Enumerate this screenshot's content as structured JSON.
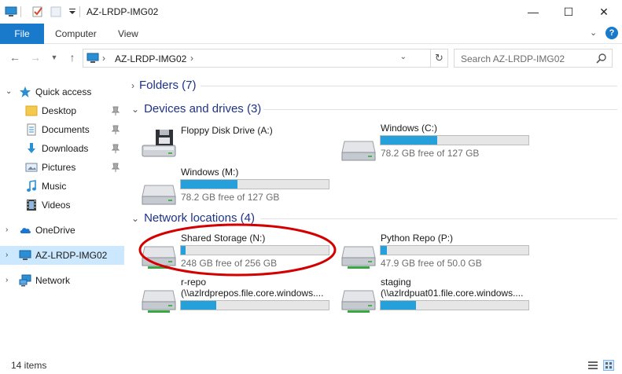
{
  "window": {
    "title": "AZ-LRDP-IMG02",
    "minimize": "—",
    "maximize": "☐",
    "close": "✕"
  },
  "ribbon": {
    "file": "File",
    "computer": "Computer",
    "view": "View",
    "help": "?"
  },
  "address": {
    "path": "AZ-LRDP-IMG02",
    "search_placeholder": "Search AZ-LRDP-IMG02"
  },
  "sidebar": {
    "quick_access": "Quick access",
    "desktop": "Desktop",
    "documents": "Documents",
    "downloads": "Downloads",
    "pictures": "Pictures",
    "music": "Music",
    "videos": "Videos",
    "onedrive": "OneDrive",
    "this_pc": "AZ-LRDP-IMG02",
    "network": "Network"
  },
  "groups": {
    "folders": "Folders (7)",
    "devices": "Devices and drives (3)",
    "network": "Network locations (4)"
  },
  "devices": {
    "floppy": {
      "name": "Floppy Disk Drive (A:)"
    },
    "c": {
      "name": "Windows (C:)",
      "free": "78.2 GB free of 127 GB",
      "used_fraction": 0.384
    },
    "m": {
      "name": "Windows (M:)",
      "free": "78.2 GB free of 127 GB",
      "used_fraction": 0.384
    }
  },
  "network_locations": {
    "n": {
      "name": "Shared Storage (N:)",
      "free": "248 GB free of 256 GB",
      "used_fraction": 0.031
    },
    "p": {
      "name": "Python Repo (P:)",
      "free": "47.9 GB free of 50.0 GB",
      "used_fraction": 0.042
    },
    "r": {
      "name": "r-repo",
      "path": "(\\\\azlrdprepos.file.core.windows....",
      "used_fraction": 0.24
    },
    "s": {
      "name": "staging",
      "path": "(\\\\azlrdpuat01.file.core.windows....",
      "used_fraction": 0.24
    }
  },
  "status": {
    "count": "14 items"
  },
  "colors": {
    "accent": "#1979ca",
    "bar_fill": "#26a0da",
    "group_header": "#1e3287",
    "selected": "#cce8ff",
    "annotation": "#d40000"
  }
}
